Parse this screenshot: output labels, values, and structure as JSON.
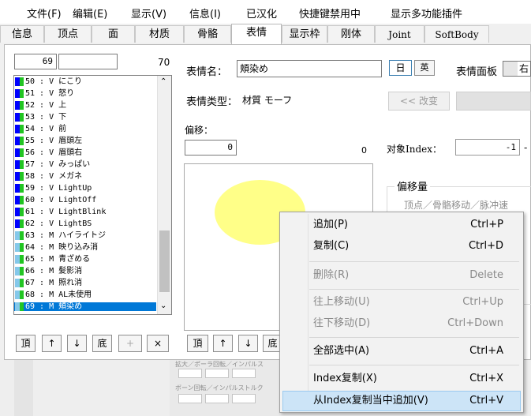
{
  "menubar": [
    "文件(F)",
    "编辑(E)",
    "显示(V)",
    "信息(I)",
    "已汉化",
    "快捷键禁用中",
    "显示多功能插件"
  ],
  "tabs": [
    "信息",
    "顶点",
    "面",
    "材质",
    "骨骼",
    "表情",
    "显示枠",
    "刚体",
    "Joint",
    "SoftBody"
  ],
  "active_tab": "表情",
  "index_value": "69",
  "index_name": "",
  "count": "70",
  "morph_name_label": "表情名：",
  "morph_name_value": "頬染め",
  "lang_jp": "日",
  "lang_en": "英",
  "panel_label": "表情面板",
  "panel_value": "右",
  "morph_type_label": "表情类型：",
  "morph_type_value": "材質 モーフ",
  "rename_btn": "<< 改变",
  "offset_label": "偏移：",
  "offset_value": "0",
  "offset_count": "0",
  "target_index_label": "对象Index：",
  "target_index_value": "-1",
  "offset_amount_label": "偏移量",
  "offset_types": "顶点／骨骼移动／脉冲速",
  "list_rows": [
    {
      "text": "50 : V  にこり",
      "color": "#0000ff"
    },
    {
      "text": "51 : V  怒り",
      "color": "#0000ff"
    },
    {
      "text": "52 : V  上",
      "color": "#0000ff"
    },
    {
      "text": "53 : V  下",
      "color": "#0000ff"
    },
    {
      "text": "54 : V  前",
      "color": "#0000ff"
    },
    {
      "text": "55 : V  眉頭左",
      "color": "#0000ff"
    },
    {
      "text": "56 : V  眉頭右",
      "color": "#0000ff"
    },
    {
      "text": "57 : V  みっぱい",
      "color": "#0000ff"
    },
    {
      "text": "58 : V  メガネ",
      "color": "#0000ff"
    },
    {
      "text": "59 : V  LightUp",
      "color": "#0000ff"
    },
    {
      "text": "60 : V  LightOff",
      "color": "#0000ff"
    },
    {
      "text": "61 : V  LightBlink",
      "color": "#0000ff"
    },
    {
      "text": "62 : V  LightBS",
      "color": "#0000ff"
    },
    {
      "text": "63 : M  ハイライトジ",
      "color": "#85c8ea"
    },
    {
      "text": "64 : M  映り込み消",
      "color": "#85c8ea"
    },
    {
      "text": "65 : M  青ざめる",
      "color": "#85c8ea"
    },
    {
      "text": "66 : M  髪影消",
      "color": "#85c8ea"
    },
    {
      "text": "67 : M  照れ消",
      "color": "#85c8ea"
    },
    {
      "text": "68 : M  AL未使用",
      "color": "#85c8ea"
    },
    {
      "text": "69 : M  頬染め",
      "color": "#85c8ea"
    }
  ],
  "list_buttons": [
    "頂",
    "↑",
    "↓",
    "底",
    "+",
    "×"
  ],
  "offset_buttons": [
    "頂",
    "↑",
    "↓",
    "底"
  ],
  "context_menu": [
    {
      "label": "追加(P)",
      "shortcut": "Ctrl+P",
      "disabled": false
    },
    {
      "label": "复制(C)",
      "shortcut": "Ctrl+D",
      "disabled": false
    },
    {
      "label": "删除(R)",
      "shortcut": "Delete",
      "disabled": true
    },
    {
      "label": "往上移动(U)",
      "shortcut": "Ctrl+Up",
      "disabled": true
    },
    {
      "label": "往下移动(D)",
      "shortcut": "Ctrl+Down",
      "disabled": true
    },
    {
      "label": "全部选中(A)",
      "shortcut": "Ctrl+A",
      "disabled": false
    },
    {
      "label": "Index复制(X)",
      "shortcut": "Ctrl+X",
      "disabled": false
    },
    {
      "label": "从Index复制当中追加(V)",
      "shortcut": "Ctrl+V",
      "disabled": false
    }
  ],
  "bg_labels": [
    "拡大／ポーラ回転／インパルス",
    "ボーン回転／インパルストルク"
  ],
  "colors": {
    "accent": "#0078d7",
    "bone_green": "#22c522",
    "material_blue": "#85c8ea",
    "vertex_blue": "#0000ff",
    "highlight": "#cce4f7",
    "yellow_circle": "#ffff88"
  }
}
